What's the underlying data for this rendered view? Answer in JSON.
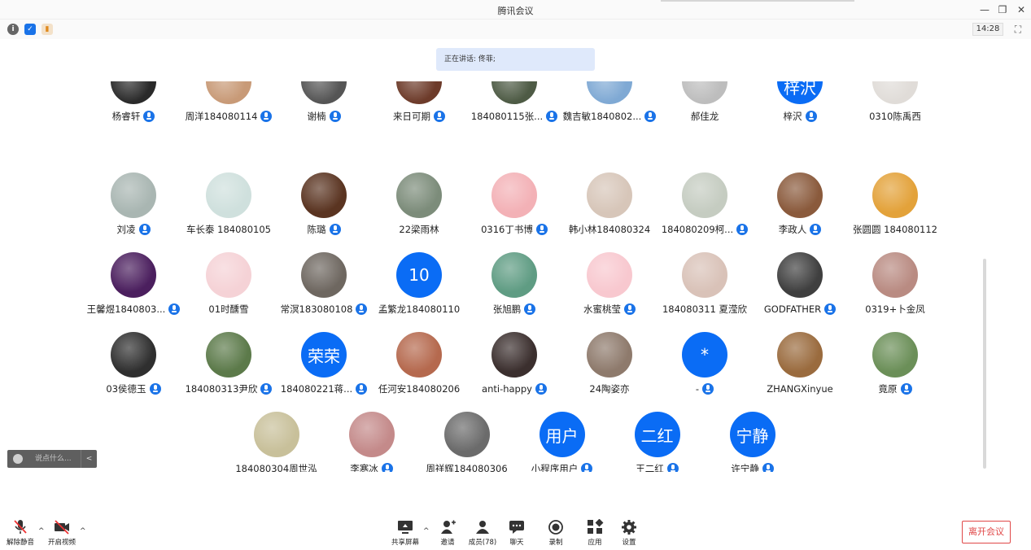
{
  "window": {
    "title": "腾讯会议"
  },
  "infobar": {
    "time": "14:28"
  },
  "banner": {
    "speaking_text": "正在讲话: 佟菲;"
  },
  "participants": [
    {
      "name": "杨睿轩",
      "mic": true,
      "avatar_color": "#2a2a2a"
    },
    {
      "name": "周洋184080114",
      "mic": true,
      "avatar_color": "#c89a77"
    },
    {
      "name": "谢楠",
      "mic": true,
      "avatar_color": "#555555"
    },
    {
      "name": "来日可期",
      "mic": true,
      "avatar_color": "#6d3b2a"
    },
    {
      "name": "184080115张...",
      "mic": true,
      "avatar_color": "#4e5b45"
    },
    {
      "name": "魏吉敏1840802...",
      "mic": true,
      "avatar_color": "#7fa9d4"
    },
    {
      "name": "郝佳龙",
      "mic": false,
      "avatar_color": "#bdbdbd"
    },
    {
      "name": "梓沢",
      "mic": true,
      "text": "梓沢"
    },
    {
      "name": "0310陈禹西",
      "mic": false,
      "avatar_color": "#e0dcd8"
    },
    {
      "name": "刘凌",
      "mic": true,
      "avatar_color": "#a9b6b2"
    },
    {
      "name": "车长泰 184080105",
      "mic": false,
      "avatar_color": "#cfe0dd"
    },
    {
      "name": "陈璐",
      "mic": true,
      "avatar_color": "#5a3421"
    },
    {
      "name": "22梁雨林",
      "mic": false,
      "avatar_color": "#7c8c7a"
    },
    {
      "name": "0316丁书博",
      "mic": true,
      "avatar_color": "#f3b1b6"
    },
    {
      "name": "韩小林184080324",
      "mic": false,
      "avatar_color": "#d7c6b9"
    },
    {
      "name": "184080209柯...",
      "mic": true,
      "avatar_color": "#c5ccc1"
    },
    {
      "name": "李政人",
      "mic": true,
      "avatar_color": "#8a5a3c"
    },
    {
      "name": "张圆圆 184080112",
      "mic": false,
      "avatar_color": "#e3a23a"
    },
    {
      "name": "王馨煜1840803...",
      "mic": true,
      "avatar_color": "#4b1f5e"
    },
    {
      "name": "01时醺雪",
      "mic": false,
      "avatar_color": "#f5d2d6"
    },
    {
      "name": "常溟183080108",
      "mic": true,
      "avatar_color": "#6e6760"
    },
    {
      "name": "孟繁龙184080110",
      "mic": false,
      "text": "10"
    },
    {
      "name": "张旭鹏",
      "mic": true,
      "avatar_color": "#5f9c83"
    },
    {
      "name": "水蜜桃莹",
      "mic": true,
      "avatar_color": "#f8c8cf"
    },
    {
      "name": "184080311 夏滢欣",
      "mic": false,
      "avatar_color": "#d9c2b8"
    },
    {
      "name": "GODFATHER",
      "mic": true,
      "avatar_color": "#3f3f3f"
    },
    {
      "name": "0319+卜金凤",
      "mic": false,
      "avatar_color": "#b98b82"
    },
    {
      "name": "03侯德玉",
      "mic": true,
      "avatar_color": "#2f2f2f"
    },
    {
      "name": "184080313尹欣",
      "mic": true,
      "avatar_color": "#5c7a4a"
    },
    {
      "name": "184080221蒋...",
      "mic": true,
      "text": "荣荣"
    },
    {
      "name": "任河安184080206",
      "mic": false,
      "avatar_color": "#b5694e"
    },
    {
      "name": "anti-happy",
      "mic": true,
      "avatar_color": "#3b2f2e"
    },
    {
      "name": "24陶姿亦",
      "mic": false,
      "avatar_color": "#8e7a6c"
    },
    {
      "name": "-",
      "mic": true,
      "text": "*"
    },
    {
      "name": "ZHANGXinyue",
      "mic": false,
      "avatar_color": "#9a6b3e"
    },
    {
      "name": "竟原",
      "mic": true,
      "avatar_color": "#6b8f58"
    },
    {
      "name": "184080304周世泓",
      "mic": false,
      "avatar_color": "#c8c09a"
    },
    {
      "name": "李寒冰",
      "mic": true,
      "avatar_color": "#c48a8a"
    },
    {
      "name": "周祥辉184080306",
      "mic": false,
      "avatar_color": "#6b6b6b"
    },
    {
      "name": "小程序用户",
      "mic": true,
      "text": "用户"
    },
    {
      "name": "王二红",
      "mic": true,
      "text": "二红"
    },
    {
      "name": "许宁静",
      "mic": true,
      "text": "宁静"
    }
  ],
  "chat": {
    "placeholder": "说点什么...",
    "toggle": "<"
  },
  "toolbar": {
    "unmute": "解除静音",
    "video": "开启视频",
    "share": "共享屏幕",
    "invite": "邀请",
    "members": "成员(78)",
    "chat": "聊天",
    "record": "录制",
    "apps": "应用",
    "settings": "设置",
    "leave": "离开会议"
  }
}
